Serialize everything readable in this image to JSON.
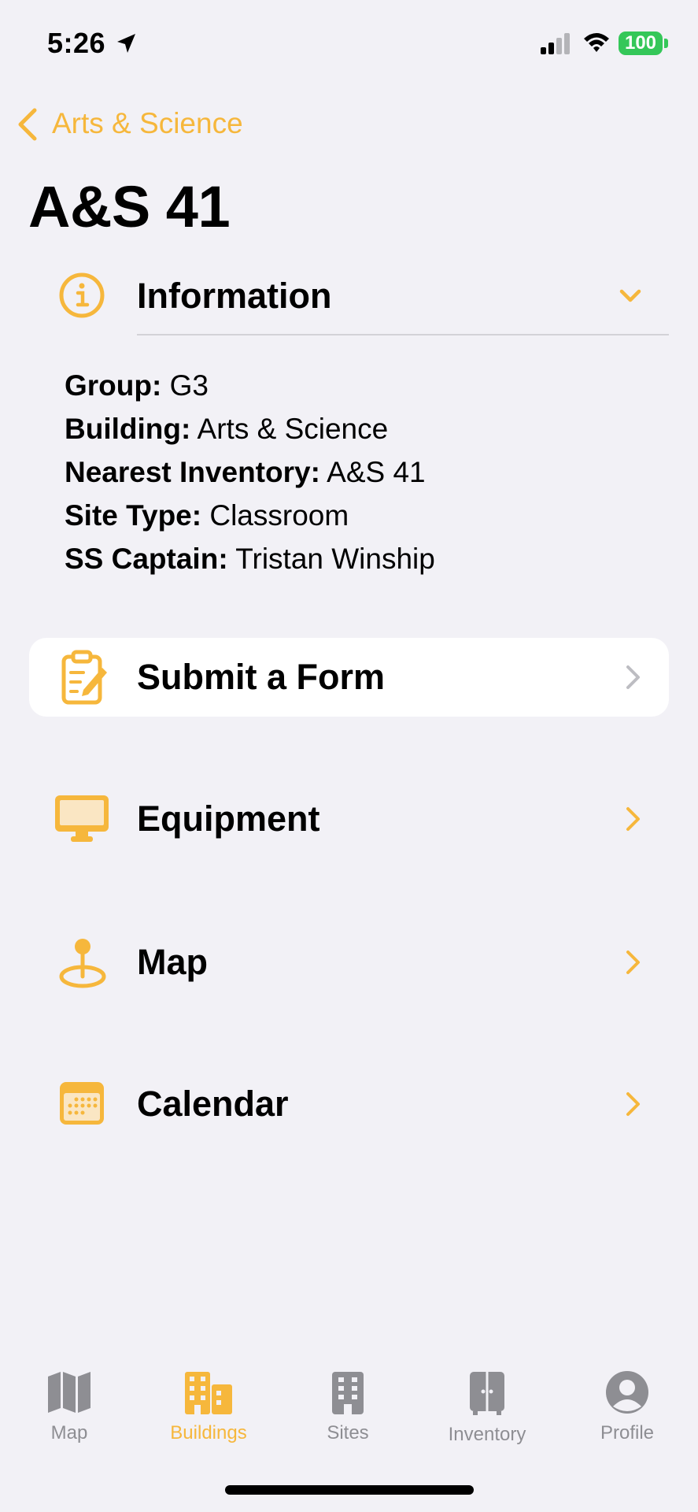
{
  "status_bar": {
    "time": "5:26",
    "battery": "100"
  },
  "nav": {
    "back_label": "Arts & Science"
  },
  "page": {
    "title": "A&S 41"
  },
  "information": {
    "title": "Information",
    "fields": [
      {
        "label": "Group:",
        "value": "G3"
      },
      {
        "label": "Building:",
        "value": "Arts & Science"
      },
      {
        "label": "Nearest Inventory:",
        "value": "A&S 41"
      },
      {
        "label": "Site Type:",
        "value": "Classroom"
      },
      {
        "label": "SS Captain:",
        "value": "Tristan Winship"
      }
    ]
  },
  "rows": [
    {
      "label": "Submit a Form",
      "icon": "clipboard-edit-icon"
    },
    {
      "label": "Equipment",
      "icon": "display-icon"
    },
    {
      "label": "Map",
      "icon": "map-pin-icon"
    },
    {
      "label": "Calendar",
      "icon": "calendar-icon"
    }
  ],
  "tab_bar": {
    "selected": "Buildings",
    "tabs": [
      {
        "label": "Map",
        "icon": "map-icon"
      },
      {
        "label": "Buildings",
        "icon": "buildings-icon"
      },
      {
        "label": "Sites",
        "icon": "building-icon"
      },
      {
        "label": "Inventory",
        "icon": "cabinet-icon"
      },
      {
        "label": "Profile",
        "icon": "person-circle-icon"
      }
    ]
  },
  "colors": {
    "accent": "#F6B73C",
    "background": "#F2F1F6",
    "inactive_tab": "#8E8E93",
    "battery": "#35C759"
  }
}
